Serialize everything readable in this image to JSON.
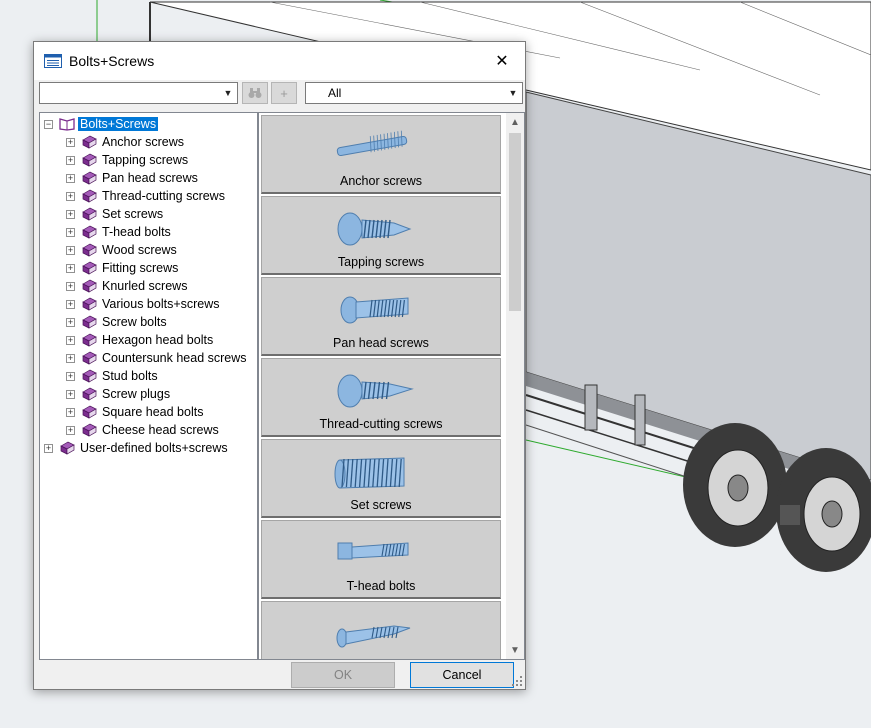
{
  "dialog": {
    "title": "Bolts+Screws",
    "close_symbol": "✕",
    "search_value": "",
    "filter_value": "All",
    "ok_label": "OK",
    "cancel_label": "Cancel"
  },
  "tree": {
    "root_label": "Bolts+Screws",
    "items": [
      {
        "label": "Anchor screws"
      },
      {
        "label": "Tapping screws"
      },
      {
        "label": "Pan head screws"
      },
      {
        "label": "Thread-cutting screws"
      },
      {
        "label": "Set screws"
      },
      {
        "label": "T-head bolts"
      },
      {
        "label": "Wood screws"
      },
      {
        "label": "Fitting screws"
      },
      {
        "label": "Knurled screws"
      },
      {
        "label": "Various bolts+screws"
      },
      {
        "label": "Screw bolts"
      },
      {
        "label": "Hexagon head bolts"
      },
      {
        "label": "Countersunk head screws"
      },
      {
        "label": "Stud bolts"
      },
      {
        "label": "Screw plugs"
      },
      {
        "label": "Square head bolts"
      },
      {
        "label": "Cheese head screws"
      }
    ],
    "user_defined_label": "User-defined bolts+screws"
  },
  "gallery": {
    "tiles": [
      {
        "label": "Anchor screws",
        "icon": "anchor-screw-icon"
      },
      {
        "label": "Tapping screws",
        "icon": "tapping-screw-icon"
      },
      {
        "label": "Pan head screws",
        "icon": "pan-head-screw-icon"
      },
      {
        "label": "Thread-cutting screws",
        "icon": "thread-cutting-screw-icon"
      },
      {
        "label": "Set screws",
        "icon": "set-screw-icon"
      },
      {
        "label": "T-head bolts",
        "icon": "t-head-bolt-icon"
      },
      {
        "label": "",
        "icon": "wood-screw-icon"
      }
    ]
  },
  "colors": {
    "selection": "#0078d7",
    "book": "#7b2d8e",
    "tile": "#cfcfcf",
    "screw": "#7aa7d6"
  }
}
